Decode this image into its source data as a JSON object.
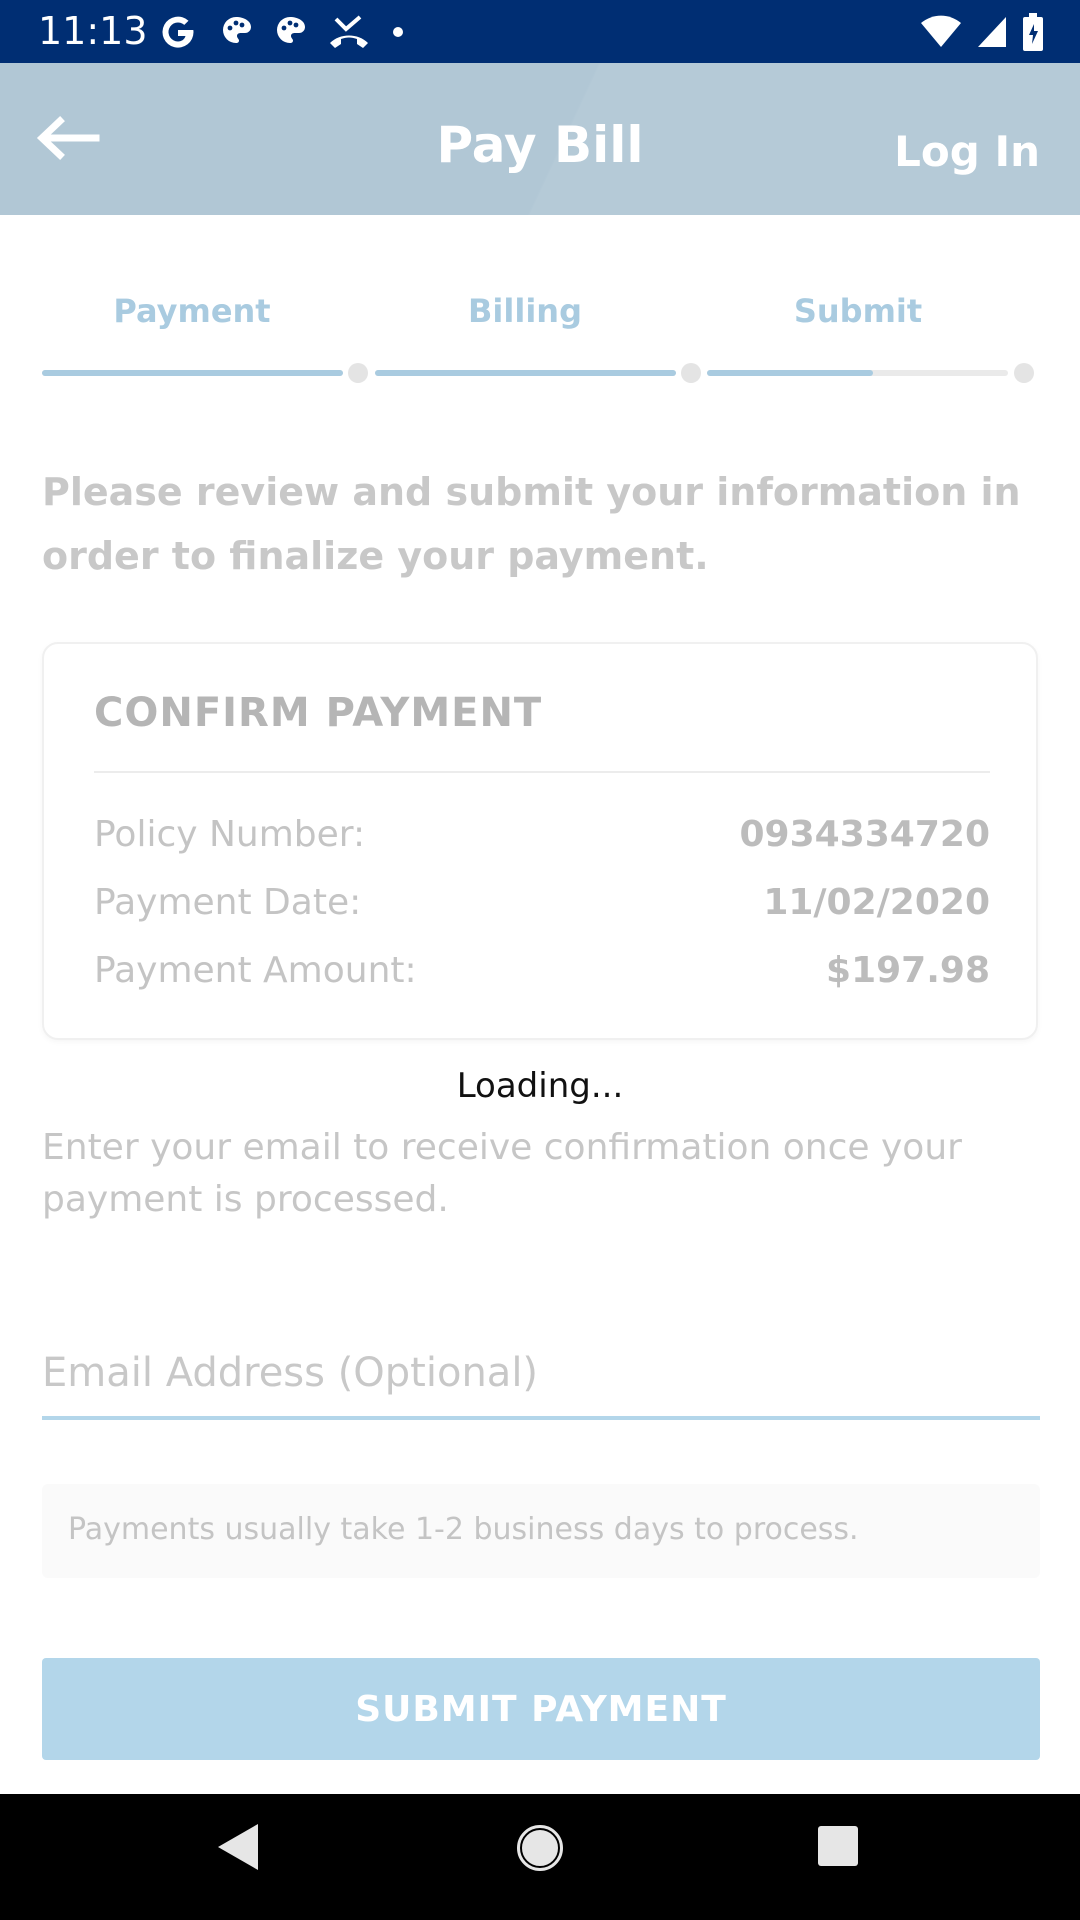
{
  "status_bar": {
    "time": "11:13",
    "left_icons": [
      "google-icon",
      "notification-icon",
      "notification-icon",
      "missed-call-icon",
      "dot-icon"
    ],
    "right_icons": [
      "wifi-icon",
      "signal-icon",
      "battery-icon"
    ]
  },
  "app_bar": {
    "title": "Pay Bill",
    "login_label": "Log In",
    "back_icon": "back-arrow-icon",
    "color": "#b1c7d5"
  },
  "stepper": {
    "steps": [
      {
        "label": "Payment",
        "progress": 1.0
      },
      {
        "label": "Billing",
        "progress": 1.0
      },
      {
        "label": "Submit",
        "progress": 0.55
      }
    ],
    "accent": "#a9cbe0"
  },
  "intro_text": "Please review and submit your information in order to finalize your payment.",
  "confirm": {
    "title": "CONFIRM PAYMENT",
    "rows": [
      {
        "label": "Policy Number:",
        "value": "0934334720"
      },
      {
        "label": "Payment Date:",
        "value": "11/02/2020"
      },
      {
        "label": "Payment Amount:",
        "value": "$197.98"
      }
    ]
  },
  "loading_text": "Loading...",
  "email": {
    "help_text": "Enter your email to receive confirmation once your payment is processed.",
    "placeholder": "Email Address (Optional)"
  },
  "notice_text": "Payments usually take 1-2 business days to process.",
  "submit_label": "SUBMIT PAYMENT",
  "nav_bar": {
    "icons": [
      "back-triangle-icon",
      "home-circle-icon",
      "recents-square-icon"
    ]
  }
}
